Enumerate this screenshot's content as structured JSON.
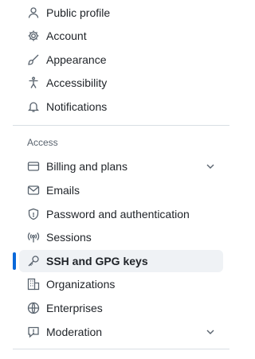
{
  "nav": {
    "items_top": [
      {
        "label": "Public profile",
        "icon": "person-icon"
      },
      {
        "label": "Account",
        "icon": "gear-icon"
      },
      {
        "label": "Appearance",
        "icon": "paintbrush-icon"
      },
      {
        "label": "Accessibility",
        "icon": "accessibility-icon"
      },
      {
        "label": "Notifications",
        "icon": "bell-icon"
      }
    ],
    "access_title": "Access",
    "access_items": [
      {
        "label": "Billing and plans",
        "icon": "credit-card-icon",
        "expandable": true
      },
      {
        "label": "Emails",
        "icon": "mail-icon"
      },
      {
        "label": "Password and authentication",
        "icon": "shield-lock-icon"
      },
      {
        "label": "Sessions",
        "icon": "broadcast-icon"
      },
      {
        "label": "SSH and GPG keys",
        "icon": "key-icon",
        "active": true
      },
      {
        "label": "Organizations",
        "icon": "organization-icon"
      },
      {
        "label": "Enterprises",
        "icon": "globe-icon"
      },
      {
        "label": "Moderation",
        "icon": "report-icon",
        "expandable": true
      }
    ]
  },
  "colors": {
    "accent": "#0969da",
    "active_bg": "#eff2f5",
    "muted": "#59636e",
    "divider": "#d8dee4"
  }
}
